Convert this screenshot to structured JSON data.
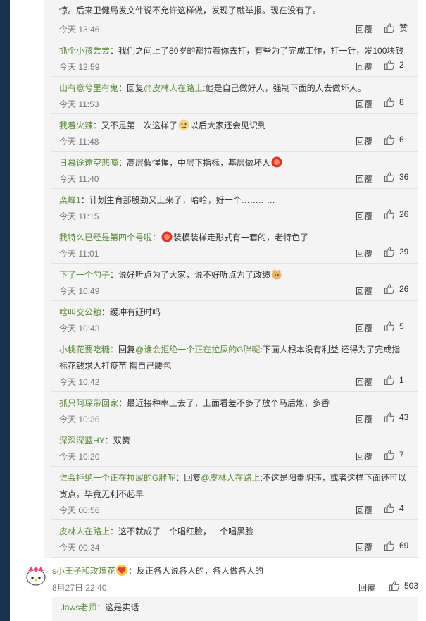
{
  "reply_label": "回覆",
  "comments": [
    {
      "user": "",
      "sep": "",
      "text": "惊。后来卫健局发文件说不允许这样做，发现了就举报。现在没有了。",
      "time": "今天 13:46",
      "likes": "赞"
    },
    {
      "user": "抓个小孩尝尝",
      "sep": "：",
      "text": "我们之间上了80岁的都拉着你去打，有些为了完成工作，打一针，发100块钱",
      "time": "今天 12:59",
      "likes": "2"
    },
    {
      "user": "山有意兮里有鬼",
      "sep": "：",
      "reply_prefix": "回复",
      "mention": "@皮林人在路上",
      "text": ":他是自己做好人，强制下面的人去做坏人。",
      "time": "今天 11:53",
      "likes": "8"
    },
    {
      "user": "我着火辣",
      "sep": "：",
      "text": "又不是第一次这样了",
      "emoji": "doge",
      "text2": "以后大家还会见识到",
      "time": "今天 11:48",
      "likes": "6"
    },
    {
      "user": "日暮途遠空悲嘆",
      "sep": "：",
      "text": "高层假惺惺，中层下指标，基层做坏人",
      "emoji": "red",
      "time": "今天 11:40",
      "likes": "36"
    },
    {
      "user": "栾峰1",
      "sep": "：",
      "text": "计划生育那股劲又上来了，哈哈，好一个…………",
      "time": "今天 11:15",
      "likes": "26"
    },
    {
      "user": "我特么已经是第四个号啦",
      "sep": "：",
      "emoji": "red",
      "text": "装模装样走形式有一套的，老特色了",
      "time": "今天 11:01",
      "likes": "29"
    },
    {
      "user": "下了一个勺子",
      "sep": "：",
      "text": "说好听点为了大家，说不好听点为了政绩",
      "emoji": "cat",
      "time": "今天 10:49",
      "likes": "26"
    },
    {
      "user": "啥叫交公粮",
      "sep": "：",
      "text": "缓冲有延时吗",
      "time": "今天 10:43",
      "likes": "5"
    },
    {
      "user": "小桃花要吃糖",
      "sep": "：",
      "reply_prefix": "回复",
      "mention": "@谁会拒绝一个正在拉屎的G胖呢",
      "text": ":下面人根本没有利益 还得为了完成指标花钱求人打疫苗 掏自己腰包",
      "time": "今天 10:42",
      "likes": "1"
    },
    {
      "user": "抓只阿琛带回家",
      "sep": "：",
      "text": "最近接种率上去了，上面看差不多了放个马后炮，多香",
      "time": "今天 10:36",
      "likes": "43"
    },
    {
      "user": "深深深蓝HY",
      "sep": "：",
      "text": "双簧",
      "time": "今天 10:20",
      "likes": "7"
    },
    {
      "user": "谁会拒绝一个正在拉屎的G胖呢",
      "sep": "：",
      "reply_prefix": "回复",
      "mention": "@皮林人在路上",
      "text": ":不这是阳奉阴违，或者这样下面还可以贪点，毕竟无利不起早",
      "time": "今天 00:56",
      "likes": "4"
    },
    {
      "user": "皮林人在路上",
      "sep": "：",
      "text": "这不就成了一个唱红脸，一个唱黑脸",
      "time": "今天 00:34",
      "likes": "69"
    }
  ],
  "main_comment": {
    "user": "s小王子和玫瑰花",
    "emoji": "heart",
    "sep": "：",
    "text": "反正各人说各人的，各人做各人的",
    "time": "8月27日 22:40",
    "likes": "503"
  },
  "sub_comment": {
    "user": "Jaws老师",
    "sep": "：",
    "text": "这是实话"
  }
}
